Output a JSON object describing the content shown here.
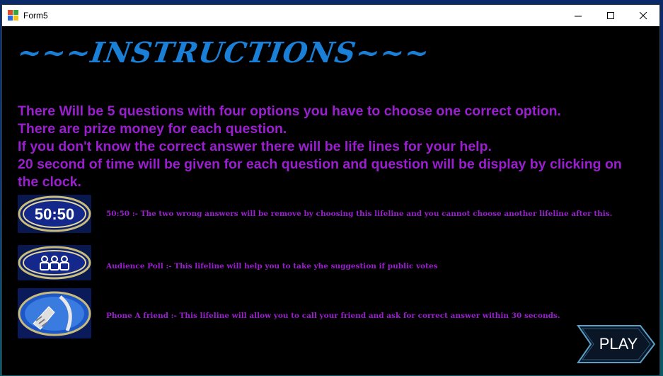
{
  "window": {
    "title": "Form5"
  },
  "heading": "~~~INSTRUCTIONS~~~",
  "instructions": [
    "There Will be 5 questions with four options you have to choose one correct option.",
    "There are prize money for each question.",
    "If you don't know the correct answer there will be life lines for your help.",
    "20 second of time will be given for each question and question will be display by clicking on the clock."
  ],
  "lifelines": [
    {
      "icon": "fifty-fifty-icon",
      "icon_text": "50:50",
      "text": "50:50  :-  The two wrong answers will be remove by choosing this lifeline and you cannot choose another lifeline after this."
    },
    {
      "icon": "audience-poll-icon",
      "text": "Audience Poll :-  This lifeline will help you to take yhe suggestion if public votes"
    },
    {
      "icon": "phone-a-friend-icon",
      "text": "Phone A friend :- This lifeline will allow you to call your friend and ask for correct answer within 30 seconds."
    }
  ],
  "play_label": "PLAY",
  "colors": {
    "heading": "#1a7fd6",
    "text": "#9b1fd0",
    "background": "#000000"
  }
}
